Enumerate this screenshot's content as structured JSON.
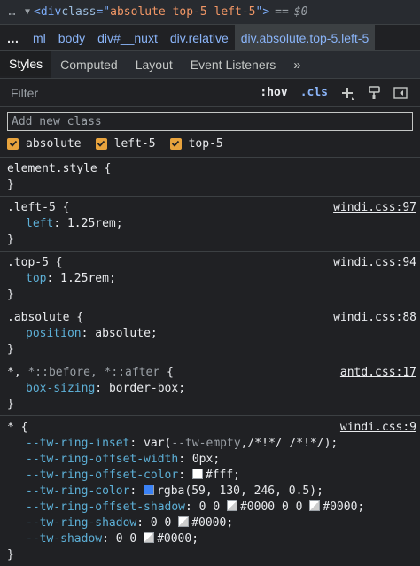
{
  "node_line": {
    "dots": "…",
    "tag_open": "<div ",
    "attr": "class",
    "eq_quote": "=\"",
    "value": "absolute top-5 left-5",
    "close": "\">",
    "equals": "==",
    "ref": "$0"
  },
  "breadcrumbs": {
    "more": "…",
    "items": [
      "ml",
      "body",
      "div#__nuxt",
      "div.relative",
      "div.absolute.top-5.left-5"
    ]
  },
  "tabs": [
    "Styles",
    "Computed",
    "Layout",
    "Event Listeners",
    "»"
  ],
  "filter": {
    "placeholder": "Filter",
    "hov": ":hov",
    "cls": ".cls"
  },
  "class_pane": {
    "placeholder": "Add new class",
    "classes": [
      "absolute",
      "left-5",
      "top-5"
    ]
  },
  "rules": {
    "element": {
      "selector": "element.style",
      "open": " {",
      "close": "}"
    },
    "left": {
      "selector": ".left-5",
      "open": " {",
      "source": "windi.css:97",
      "prop": "left",
      "value": "1.25rem",
      "close": "}"
    },
    "top": {
      "selector": ".top-5",
      "open": " {",
      "source": "windi.css:94",
      "prop": "top",
      "value": "1.25rem",
      "close": "}"
    },
    "absolute": {
      "selector": ".absolute",
      "open": " {",
      "source": "windi.css:88",
      "prop": "position",
      "value": "absolute",
      "close": "}"
    },
    "universal": {
      "selector_main": "*,",
      "selector_dim": " *::before, *::after",
      "open": " {",
      "source": "antd.css:17",
      "prop": "box-sizing",
      "value": "border-box",
      "close": "}"
    },
    "star": {
      "selector": "*",
      "open": " {",
      "source": "windi.css:9",
      "close": "}",
      "p1": "--tw-ring-inset",
      "v1a": "var(",
      "v1b": "--tw-empty",
      "v1c": ",/*!*/ /*!*/);",
      "p2": "--tw-ring-offset-width",
      "v2": "0px;",
      "p3": "--tw-ring-offset-color",
      "v3": "#fff;",
      "c3": "#ffffff",
      "p4": "--tw-ring-color",
      "v4": "rgba(59, 130, 246, 0.5);",
      "c4": "#3b82f6",
      "p5": "--tw-ring-offset-shadow",
      "v5a": "0 0 ",
      "v5b": "#0000",
      "v5c": " 0 0 ",
      "v5d": "#0000;",
      "p6": "--tw-ring-shadow",
      "v6a": "0 0 ",
      "v6b": "#0000;",
      "p7": "--tw-shadow",
      "v7a": "0 0 ",
      "v7b": "#0000;"
    }
  },
  "colors": {
    "background": "#202124",
    "property": "#5db0d7",
    "link": "#8ab4f8",
    "checkbox": "#e8a33d"
  }
}
